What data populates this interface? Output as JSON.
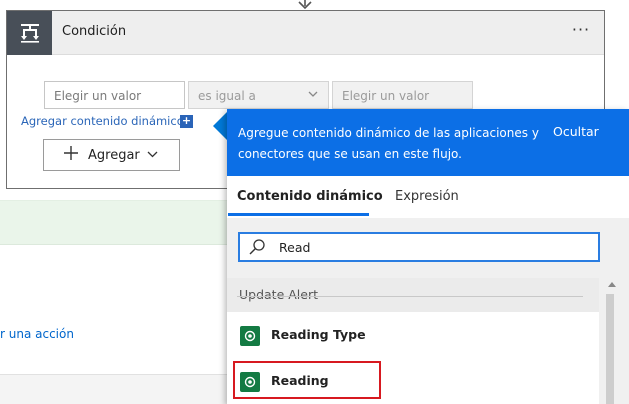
{
  "condition": {
    "title": "Condición",
    "menu_label": "···",
    "value_left_placeholder": "Elegir un valor",
    "operator_value": "es igual a",
    "value_right_placeholder": "Elegir un valor",
    "add_dynamic_link": "Agregar contenido dinámico",
    "add_dynamic_badge": "+",
    "add_button_label": "Agregar"
  },
  "background": {
    "partial_action_link": "r una acción"
  },
  "panel": {
    "message": "Agregue contenido dinámico de las aplicaciones y conectores que se usan en este flujo.",
    "hide_label": "Ocultar",
    "tabs": [
      {
        "label": "Contenido dinámico",
        "active": true
      },
      {
        "label": "Expresión",
        "active": false
      }
    ],
    "search_value": "Read",
    "section_label": "Update Alert",
    "items": [
      {
        "label": "Reading Type",
        "icon": "dataverse-icon",
        "highlighted": false
      },
      {
        "label": "Reading",
        "icon": "dataverse-icon",
        "highlighted": true
      }
    ]
  },
  "colors": {
    "accent_blue": "#0c6fe6",
    "item_icon_green": "#137a43",
    "highlight_red": "#d71920",
    "header_icon_dark": "#484f58"
  }
}
